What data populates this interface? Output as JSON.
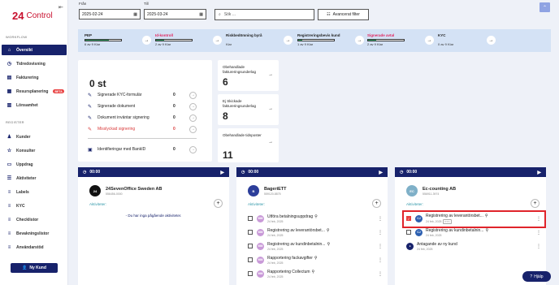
{
  "sidebar": {
    "logo_mark": "24",
    "logo_text": "Control",
    "section_workflow": "WORKFLOW",
    "section_register": "REGISTER",
    "workflow_items": [
      {
        "label": "Översikt",
        "icon": "home-icon",
        "active": true
      },
      {
        "label": "Tidredovisning",
        "icon": "clock-icon"
      },
      {
        "label": "Fakturering",
        "icon": "invoice-icon"
      },
      {
        "label": "Resursplanering",
        "icon": "calendar-icon",
        "badge": "BETA"
      },
      {
        "label": "Lönsamhet",
        "icon": "chart-icon"
      }
    ],
    "register_items": [
      {
        "label": "Kunder",
        "icon": "users-icon"
      },
      {
        "label": "Konsulter",
        "icon": "star-icon"
      },
      {
        "label": "Uppdrag",
        "icon": "folder-icon"
      },
      {
        "label": "Aktiviteter",
        "icon": "activity-icon"
      },
      {
        "label": "Labels",
        "icon": "list-icon"
      },
      {
        "label": "KYC",
        "icon": "list-icon"
      },
      {
        "label": "Checklistor",
        "icon": "list-icon"
      },
      {
        "label": "Bevakningslistor",
        "icon": "list-icon"
      },
      {
        "label": "Användarstöd",
        "icon": "list-icon"
      }
    ],
    "new_customer_label": "Ny Kund"
  },
  "filters": {
    "from_label": "Från",
    "from_value": "2025-02-24",
    "to_label": "Till",
    "to_value": "2025-03-24",
    "search_placeholder": "Sök ...",
    "advanced_filter_label": "Avancerat filter"
  },
  "kyc_steps": [
    {
      "name": "PEP",
      "sub": "6 av 9 Klar",
      "progress": 0.67,
      "red": false
    },
    {
      "name": "Id-kontroll",
      "sub": "2 av 9 Klar",
      "progress": 0.22,
      "red": true
    },
    {
      "name": "Riskbedömning byrå",
      "sub": "Klar",
      "progress": null,
      "red": false
    },
    {
      "name": "Registreringsbevis kund",
      "sub": "1 av 9 Klar",
      "progress": 0.11,
      "red": false
    },
    {
      "name": "Signerade avtal",
      "sub": "2 av 9 Klar",
      "progress": 0.22,
      "red": true
    },
    {
      "name": "KYC",
      "sub": "0 av 9 Klar",
      "progress": null,
      "red": false
    }
  ],
  "signing": {
    "total": "0 st",
    "rows": [
      {
        "label": "Signerade KYC-formulär",
        "value": "0",
        "icon": "pen-icon",
        "red": false
      },
      {
        "label": "Signerade dokument",
        "value": "0",
        "icon": "pen-icon",
        "red": false
      },
      {
        "label": "Dokument inväntar signering",
        "value": "0",
        "icon": "pen-icon",
        "red": false
      },
      {
        "label": "Misslyckad signering",
        "value": "0",
        "icon": "pen-icon",
        "red": true
      },
      {
        "label": "Identifieringar med BankID",
        "value": "0",
        "icon": "id-card-icon",
        "red": false
      }
    ]
  },
  "invoice_cards": [
    {
      "title": "Obehandlade faktureringsunderlag",
      "value": "6"
    },
    {
      "title": "Ej Skickade faktureringsunderlag",
      "value": "8"
    },
    {
      "title": "Obehandlade tidsposter",
      "value": "11"
    }
  ],
  "timers": [
    {
      "time": "00:00",
      "company": "24SevenOffice Sweden AB",
      "org": "556456-0000",
      "logo": "24",
      "logo_color": "#111111",
      "activities_label": "Aktiviteter:",
      "empty_text": "- Du har inga pågående aktiviteter.",
      "activities": []
    },
    {
      "time": "00:00",
      "company": "BageriETT",
      "org": "559120-8875",
      "logo": "B",
      "logo_color": "#2c3e9a",
      "activities_label": "Aktiviteter:",
      "activities": [
        {
          "initials": "MM",
          "title": "Utföra betalningsuppdrag",
          "date": "24 feb, 2025",
          "checked": false
        },
        {
          "initials": "MM",
          "title": "Registrering av leverantörsbet...",
          "date": "24 feb, 2025",
          "checked": false
        },
        {
          "initials": "MM",
          "title": "Registrering av kundinbetalnin...",
          "date": "24 feb, 2025",
          "checked": false
        },
        {
          "initials": "MM",
          "title": "Rapportering fackavgifter",
          "date": "24 feb, 2025",
          "checked": false
        },
        {
          "initials": "MM",
          "title": "Rapportering Collectum",
          "date": "24 feb, 2025",
          "checked": false
        }
      ]
    },
    {
      "time": "00:00",
      "company": "Ec-counting AB",
      "org": "556911-3974",
      "logo": "EC",
      "logo_color": "#7fb0c8",
      "activities_label": "Aktiviteter:",
      "activities": [
        {
          "initials": "CJ",
          "title": "Registrering av leverantörsbet...",
          "date": "24 feb, 2025",
          "checked": true,
          "tag": "KYC"
        },
        {
          "initials": "CJ",
          "title": "Registrering av kundinbetalnin...",
          "date": "24 feb, 2025",
          "checked": false
        },
        {
          "initials": "",
          "title": "Antagande av ny kund",
          "date": "24 feb, 2025",
          "checked": false,
          "person": true
        }
      ]
    }
  ],
  "help_label": "Hjälp"
}
